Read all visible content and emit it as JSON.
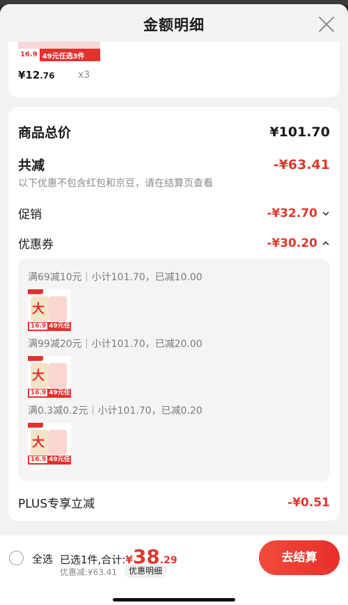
{
  "sheet": {
    "title": "金额明细"
  },
  "top_item": {
    "thumb_price": "16.9",
    "thumb_text": "49元任选3件",
    "price_main": "¥12",
    "price_dec": ".76",
    "qty": "x3"
  },
  "summary": {
    "total_label": "商品总价",
    "total_value": "¥101.70",
    "reduce_label": "共减",
    "reduce_value": "-¥63.41",
    "note": "以下优惠不包含红包和京豆，请在结算页查看",
    "promo_label": "促销",
    "promo_value": "-¥32.70",
    "coupon_label": "优惠券",
    "coupon_value": "-¥30.20",
    "plus_label": "PLUS专享立减",
    "plus_value": "-¥0.51"
  },
  "coupons": [
    {
      "line": "满69减10元｜小计101.70，已减10.00"
    },
    {
      "line": "满99减20元｜小计101.70，已减20.00"
    },
    {
      "line": "满0.3减0.2元｜小计101.70，已减0.20"
    }
  ],
  "product_thumb": {
    "price": "16.9",
    "text": "49元任选3件",
    "big": "大"
  },
  "bottom": {
    "select_all": "全选",
    "selected_text": "已选1件,合计:",
    "total_currency": "¥",
    "total_main": "38",
    "total_dec": ".29",
    "discount": "优惠减:¥63.41",
    "detail_tag": "优惠明细",
    "checkout": "去结算"
  },
  "colors": {
    "accent_red": "#e1372b",
    "button_red": "#e8302a"
  }
}
